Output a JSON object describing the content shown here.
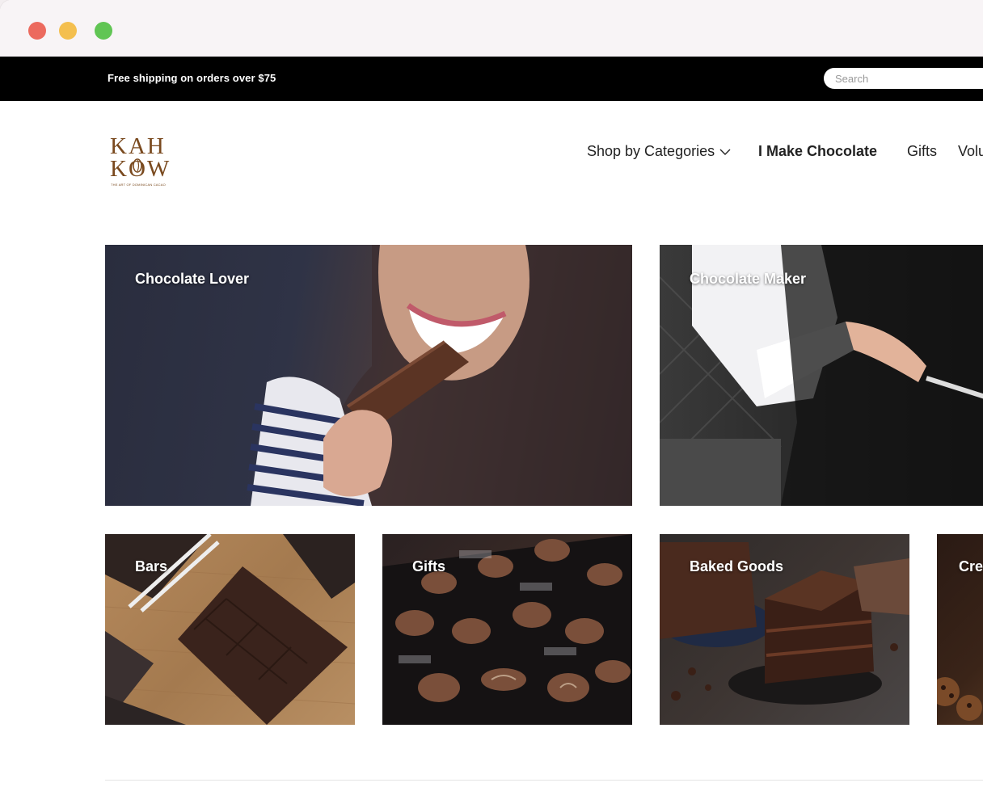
{
  "window": {
    "controls": [
      "close",
      "minimize",
      "zoom"
    ]
  },
  "topbar": {
    "promo": "Free shipping on orders over $75",
    "search_placeholder": "Search"
  },
  "brand": {
    "line1": "KAH",
    "line2": "KOW",
    "tagline": "THE ART OF DOMINICAN CACAO",
    "color": "#7a4a1f"
  },
  "nav": {
    "items": [
      {
        "label": "Shop by Categories",
        "has_dropdown": true
      },
      {
        "label": "I Make Chocolate",
        "active": true
      },
      {
        "label": "Gifts"
      },
      {
        "label": "Volu"
      }
    ]
  },
  "tiles": {
    "hero": [
      {
        "label": "Chocolate Lover"
      },
      {
        "label": "Chocolate Maker"
      }
    ],
    "categories": [
      {
        "label": "Bars"
      },
      {
        "label": "Gifts"
      },
      {
        "label": "Baked Goods"
      },
      {
        "label": "Cre"
      }
    ]
  }
}
